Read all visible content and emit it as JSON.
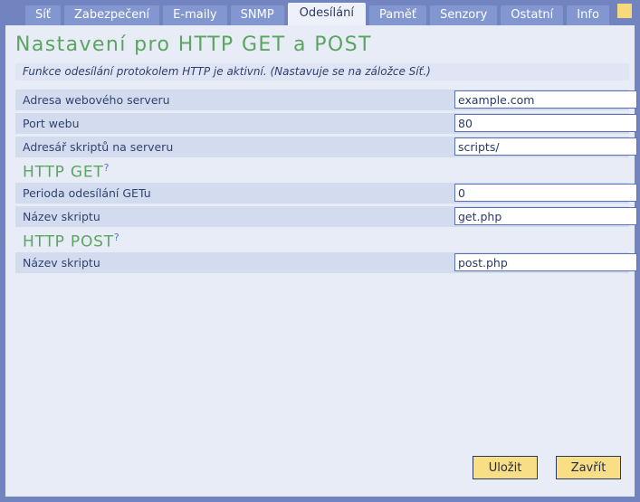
{
  "window": {
    "corner_icon": "yellow-square-indicator"
  },
  "tabs": [
    {
      "label": "Síť",
      "active": false
    },
    {
      "label": "Zabezpečení",
      "active": false
    },
    {
      "label": "E-maily",
      "active": false
    },
    {
      "label": "SNMP",
      "active": false
    },
    {
      "label": "Odesílání",
      "active": true
    },
    {
      "label": "Paměť",
      "active": false
    },
    {
      "label": "Senzory",
      "active": false
    },
    {
      "label": "Ostatní",
      "active": false
    },
    {
      "label": "Info",
      "active": false
    }
  ],
  "page": {
    "title": "Nastavení pro HTTP GET a POST",
    "subtitle": "Funkce odesílání protokolem HTTP je aktivní. (Nastavuje se na záložce Síť.)"
  },
  "server_rows": [
    {
      "label": "Adresa webového serveru",
      "value": "example.com",
      "placeholder": ""
    },
    {
      "label": "Port webu",
      "value": "80",
      "placeholder": ""
    },
    {
      "label": "Adresář skriptů na serveru",
      "value": "scripts/",
      "placeholder": ""
    }
  ],
  "get_section": {
    "title": "HTTP GET",
    "help": "?",
    "rows": [
      {
        "label": "Perioda odesílání GETu",
        "value": "0",
        "placeholder": ""
      },
      {
        "label": "Název skriptu",
        "value": "get.php",
        "placeholder": ""
      }
    ]
  },
  "post_section": {
    "title": "HTTP POST",
    "help": "?",
    "rows": [
      {
        "label": "Název skriptu",
        "value": "post.php",
        "placeholder": ""
      }
    ]
  },
  "buttons": {
    "save": "Uložit",
    "close": "Zavřít"
  },
  "colors": {
    "chrome_blue": "#7184c0",
    "tab_inactive": "#8296cf",
    "tab_active_bg": "#eef1f9",
    "page_bg": "#e8ecf7",
    "row_bg": "#d3dbef",
    "subtitle_bg": "#dfe5f4",
    "heading_green": "#5aa55f",
    "label_navy": "#31436e",
    "button_yellow": "#f8de85",
    "link_blue": "#5577c9",
    "corner_yellow": "#f5d97c"
  }
}
